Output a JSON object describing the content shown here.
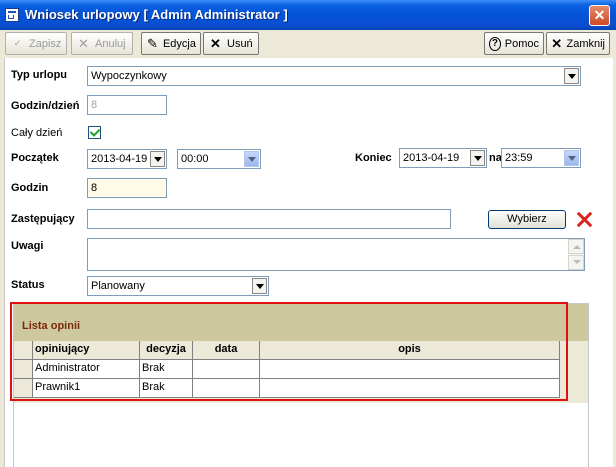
{
  "window": {
    "title": "Wniosek urlopowy [ Admin Administrator ]"
  },
  "toolbar": {
    "save": "Zapisz",
    "cancel": "Anuluj",
    "edit": "Edycja",
    "delete": "Usuń",
    "help": "Pomoc",
    "close": "Zamknij"
  },
  "form": {
    "type_label": "Typ urlopu",
    "type_value": "Wypoczynkowy",
    "hours_day_label": "Godzin/dzień",
    "hours_day_value": "8",
    "full_day_label": "Cały dzień",
    "start_label": "Początek",
    "start_date": "2013-04-19",
    "start_time": "00:00",
    "end_label": "Koniec",
    "end_date": "2013-04-19",
    "end_on_label": "na",
    "end_time": "23:59",
    "hours_label": "Godzin",
    "hours_value": "8",
    "substitute_label": "Zastępujący",
    "substitute_value": "",
    "choose_button": "Wybierz",
    "notes_label": "Uwagi",
    "notes_value": "",
    "status_label": "Status",
    "status_value": "Planowany"
  },
  "opinions": {
    "title": "Lista opinii",
    "columns": [
      "opiniujący",
      "decyzja",
      "data",
      "opis"
    ],
    "rows": [
      [
        "Administrator",
        "Brak",
        "",
        ""
      ],
      [
        "Prawnik1",
        "Brak",
        "",
        ""
      ]
    ]
  },
  "icons": {
    "save": "save-ok-icon",
    "cancel": "cancel-x-icon",
    "edit": "edit-pencil-icon",
    "delete": "delete-x-icon",
    "help": "help-question-icon",
    "close": "close-x-icon"
  }
}
